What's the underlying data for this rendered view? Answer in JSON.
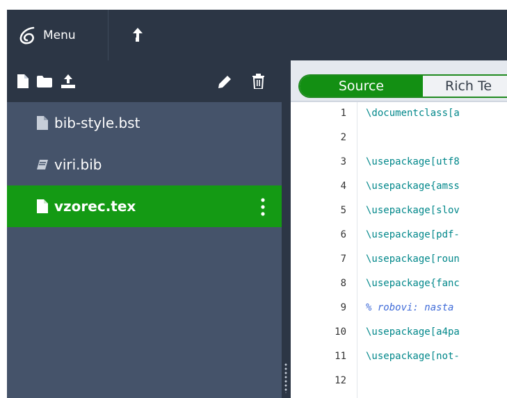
{
  "topbar": {
    "menu_label": "Menu",
    "icons": [
      "overleaf-logo-icon",
      "upload-arrow-icon"
    ]
  },
  "file_toolbar": {
    "icons": [
      "new-file-icon",
      "new-folder-icon",
      "upload-icon",
      "rename-pencil-icon",
      "delete-trash-icon"
    ]
  },
  "files": [
    {
      "name": "bib-style.bst",
      "icon": "file-icon"
    },
    {
      "name": "viri.bib",
      "icon": "book-icon"
    },
    {
      "name": "vzorec.tex",
      "icon": "file-icon",
      "selected": true
    }
  ],
  "editor": {
    "tabs": {
      "source": "Source",
      "rich": "Rich Te"
    },
    "lines": [
      {
        "num": "1",
        "text": "\\documentclass[a",
        "type": "code"
      },
      {
        "num": "2",
        "text": "",
        "type": "code"
      },
      {
        "num": "3",
        "text": "\\usepackage[utf8",
        "type": "code"
      },
      {
        "num": "4",
        "text": "\\usepackage{amss",
        "type": "code"
      },
      {
        "num": "5",
        "text": "\\usepackage[slov",
        "type": "code"
      },
      {
        "num": "6",
        "text": "\\usepackage[pdf-",
        "type": "code"
      },
      {
        "num": "7",
        "text": "\\usepackage[roun",
        "type": "code"
      },
      {
        "num": "8",
        "text": "\\usepackage{fanc",
        "type": "code"
      },
      {
        "num": "9",
        "text": "% robovi: nasta",
        "type": "comment"
      },
      {
        "num": "10",
        "text": "\\usepackage[a4pa",
        "type": "code"
      },
      {
        "num": "11",
        "text": "\\usepackage[not-",
        "type": "code"
      },
      {
        "num": "12",
        "text": "",
        "type": "code"
      }
    ]
  },
  "colors": {
    "topbar": "#2c3645",
    "sidebar": "#45536a",
    "selected": "#149a14",
    "accent_green": "#138f13",
    "code": "#00878a",
    "comment": "#3f6bd8"
  }
}
